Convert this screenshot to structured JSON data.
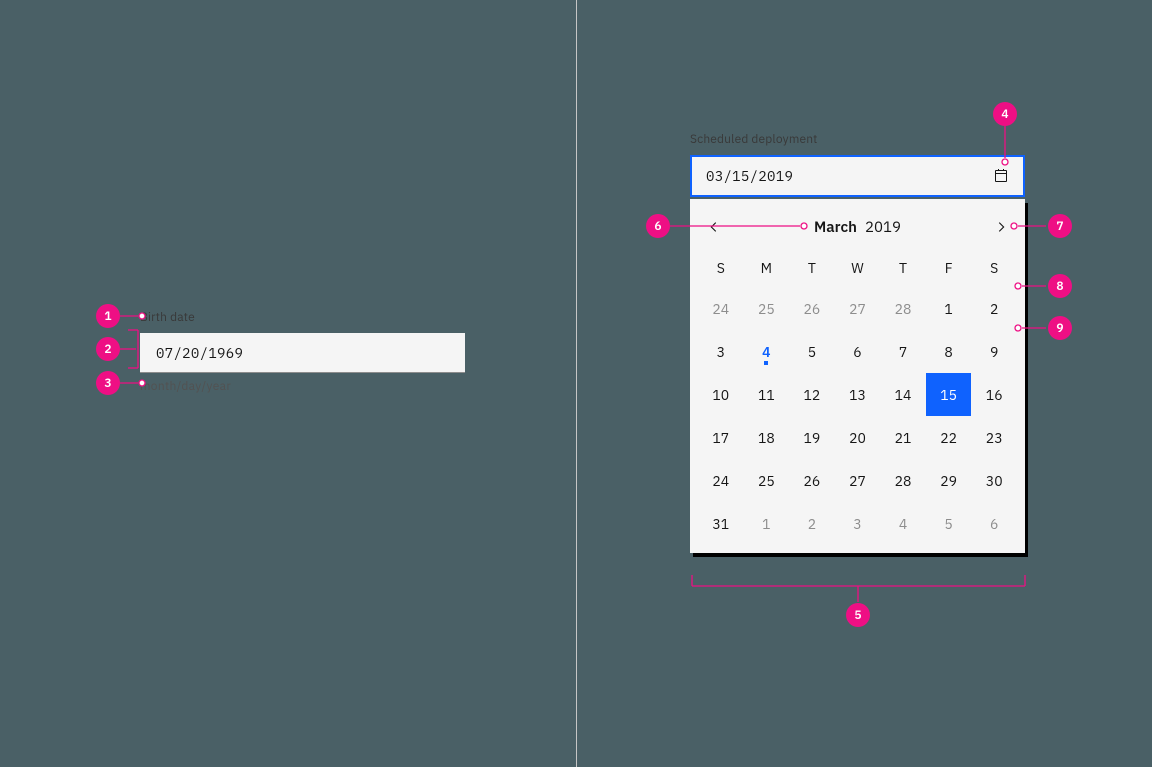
{
  "annotations": {
    "n1": "1",
    "n2": "2",
    "n3": "3",
    "n4": "4",
    "n5": "5",
    "n6": "6",
    "n7": "7",
    "n8": "8",
    "n9": "9"
  },
  "left": {
    "label": "Birth date",
    "value": "07/20/1969",
    "helper": "month/day/year"
  },
  "right": {
    "label": "Scheduled deployment",
    "value": "03/15/2019",
    "cal_month": "March",
    "cal_year": "2019",
    "dow": [
      "S",
      "M",
      "T",
      "W",
      "T",
      "F",
      "S"
    ],
    "grid": [
      {
        "d": "24",
        "t": "out"
      },
      {
        "d": "25",
        "t": "out"
      },
      {
        "d": "26",
        "t": "out"
      },
      {
        "d": "27",
        "t": "out"
      },
      {
        "d": "28",
        "t": "out"
      },
      {
        "d": "1",
        "t": "in"
      },
      {
        "d": "2",
        "t": "in"
      },
      {
        "d": "3",
        "t": "in"
      },
      {
        "d": "4",
        "t": "today"
      },
      {
        "d": "5",
        "t": "in"
      },
      {
        "d": "6",
        "t": "in"
      },
      {
        "d": "7",
        "t": "in"
      },
      {
        "d": "8",
        "t": "in"
      },
      {
        "d": "9",
        "t": "in"
      },
      {
        "d": "10",
        "t": "in"
      },
      {
        "d": "11",
        "t": "in"
      },
      {
        "d": "12",
        "t": "in"
      },
      {
        "d": "13",
        "t": "in"
      },
      {
        "d": "14",
        "t": "in"
      },
      {
        "d": "15",
        "t": "selected"
      },
      {
        "d": "16",
        "t": "in"
      },
      {
        "d": "17",
        "t": "in"
      },
      {
        "d": "18",
        "t": "in"
      },
      {
        "d": "19",
        "t": "in"
      },
      {
        "d": "20",
        "t": "in"
      },
      {
        "d": "21",
        "t": "in"
      },
      {
        "d": "22",
        "t": "in"
      },
      {
        "d": "23",
        "t": "in"
      },
      {
        "d": "24",
        "t": "in"
      },
      {
        "d": "25",
        "t": "in"
      },
      {
        "d": "26",
        "t": "in"
      },
      {
        "d": "27",
        "t": "in"
      },
      {
        "d": "28",
        "t": "in"
      },
      {
        "d": "29",
        "t": "in"
      },
      {
        "d": "30",
        "t": "in"
      },
      {
        "d": "31",
        "t": "in"
      },
      {
        "d": "1",
        "t": "out"
      },
      {
        "d": "2",
        "t": "out"
      },
      {
        "d": "3",
        "t": "out"
      },
      {
        "d": "4",
        "t": "out"
      },
      {
        "d": "5",
        "t": "out"
      },
      {
        "d": "6",
        "t": "out"
      }
    ]
  }
}
